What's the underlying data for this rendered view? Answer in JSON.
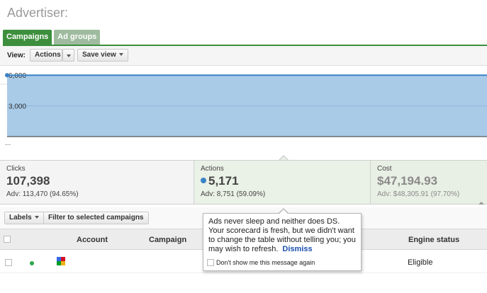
{
  "header": {
    "title": "Advertiser:"
  },
  "tabs": [
    {
      "label": "Campaigns",
      "active": true
    },
    {
      "label": "Ad groups",
      "active": false
    }
  ],
  "toolbar": {
    "view_label": "View:",
    "actions_label": "Actions",
    "save_view_label": "Save view"
  },
  "chart_data": {
    "type": "area",
    "x": [
      0,
      1
    ],
    "series": [
      {
        "values": [
          6000,
          6000
        ]
      }
    ],
    "yticks": [
      "6,000",
      "3,000"
    ],
    "ylim": [
      0,
      6500
    ],
    "grid": true,
    "fill_color": "#a9cbe8",
    "line_color": "#3a83c7"
  },
  "chart_footer": "...",
  "scorecard": [
    {
      "label": "Clicks",
      "value": "107,398",
      "adv": "Adv: 113,470 (94.65%)"
    },
    {
      "label": "Actions",
      "value": "5,171",
      "adv": "Adv: 8,751 (59.09%)"
    },
    {
      "label": "Cost",
      "value": "$47,194.93",
      "adv": "Adv: $48,305.91 (97.70%)"
    }
  ],
  "table_toolbar": {
    "labels_button": "Labels",
    "filter_button": "Filter to selected campaigns"
  },
  "table": {
    "columns": [
      "Account",
      "Campaign",
      "Engine status"
    ],
    "rows": [
      {
        "engine_status": "Eligible",
        "status_color": "#2ea64a"
      }
    ]
  },
  "popup": {
    "message": "Ads never sleep and neither does DS. Your scorecard is fresh, but we didn't want to change the table without telling you; you may wish to refresh.",
    "dismiss": "Dismiss",
    "dont_show": "Don't show me this message again"
  },
  "colors": {
    "tab_active": "#3d8f3d",
    "tab_inactive": "#9fbb9f",
    "link": "#1a4fb0"
  }
}
